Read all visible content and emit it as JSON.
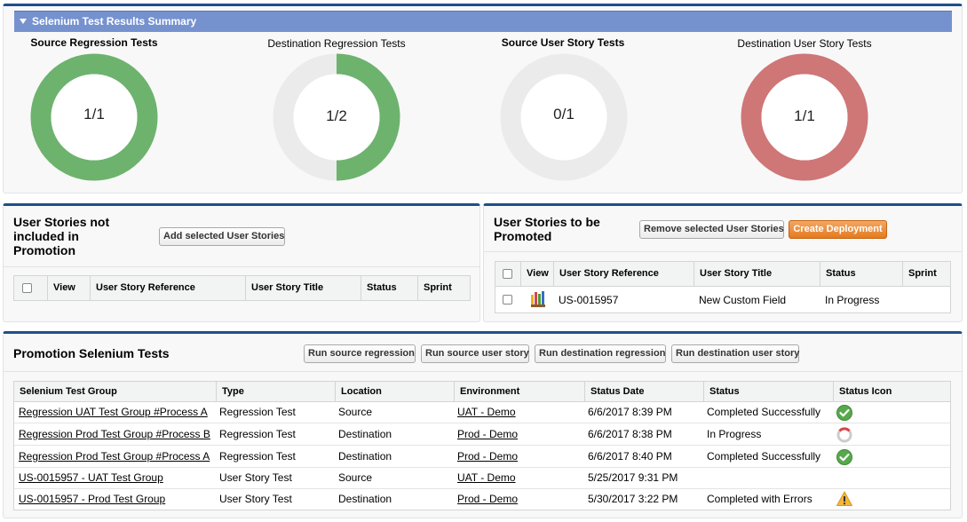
{
  "summary": {
    "header": "Selenium Test Results Summary",
    "gauges": [
      {
        "label": "Source Regression Tests",
        "value": "1/1",
        "fill_fraction": 1.0,
        "color": "#6db36e"
      },
      {
        "label": "Destination Regression Tests",
        "value": "1/2",
        "fill_fraction": 0.5,
        "color": "#6db36e"
      },
      {
        "label": "Source User Story Tests",
        "value": "0/1",
        "fill_fraction": 0.0,
        "color": "#6db36e"
      },
      {
        "label": "Destination User Story Tests",
        "value": "1/1",
        "fill_fraction": 1.0,
        "color": "#cf7677"
      }
    ]
  },
  "not_included": {
    "title_line1": "User Stories not",
    "title_line2": "included in",
    "title_line3": "Promotion",
    "add_button": "Add selected User Stories",
    "columns": [
      "View",
      "User Story Reference",
      "User Story Title",
      "Status",
      "Sprint"
    ]
  },
  "to_promote": {
    "title_line1": "User Stories to be",
    "title_line2": "Promoted",
    "remove_button": "Remove selected User Stories",
    "create_button": "Create Deployment",
    "columns": [
      "View",
      "User Story Reference",
      "User Story Title",
      "Status",
      "Sprint"
    ],
    "rows": [
      {
        "reference": "US-0015957",
        "title": "New Custom Field",
        "status": "In Progress",
        "sprint": ""
      }
    ]
  },
  "selenium": {
    "title": "Promotion Selenium Tests",
    "buttons": [
      "Run source regression",
      "Run source user story",
      "Run destination regression",
      "Run destination user story"
    ],
    "columns": [
      "Selenium Test Group",
      "Type",
      "Location",
      "Environment",
      "Status Date",
      "Status",
      "Status Icon"
    ],
    "rows": [
      {
        "group": "Regression UAT Test Group #Process A",
        "type": "Regression Test",
        "location": "Source",
        "environment": "UAT - Demo",
        "date": "6/6/2017 8:39 PM",
        "status": "Completed Successfully",
        "icon": "check-icon"
      },
      {
        "group": "Regression Prod Test Group #Process B",
        "type": "Regression Test",
        "location": "Destination",
        "environment": "Prod - Demo",
        "date": "6/6/2017 8:38 PM",
        "status": "In Progress",
        "icon": "in-progress-icon"
      },
      {
        "group": "Regression Prod Test Group #Process A",
        "type": "Regression Test",
        "location": "Destination",
        "environment": "Prod - Demo",
        "date": "6/6/2017 8:40 PM",
        "status": "Completed Successfully",
        "icon": "check-icon"
      },
      {
        "group": "US-0015957 - UAT Test Group",
        "type": "User Story Test",
        "location": "Source",
        "environment": "UAT - Demo",
        "date": "5/25/2017 9:31 PM",
        "status": "",
        "icon": ""
      },
      {
        "group": "US-0015957 - Prod Test Group",
        "type": "User Story Test",
        "location": "Destination",
        "environment": "Prod - Demo",
        "date": "5/30/2017 3:22 PM",
        "status": "Completed with Errors",
        "icon": "warning-icon"
      }
    ]
  }
}
